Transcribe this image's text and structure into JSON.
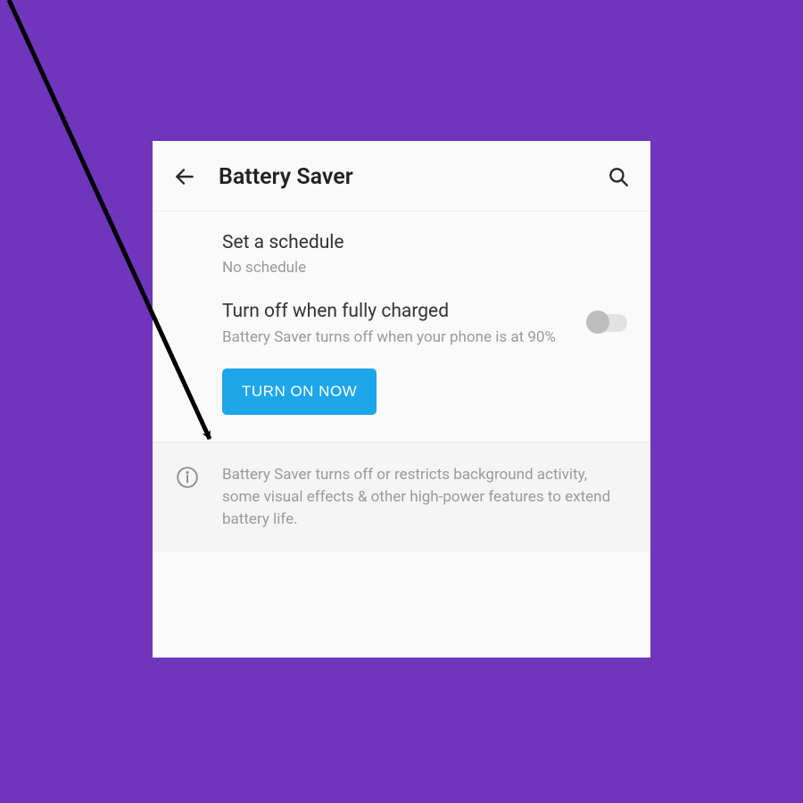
{
  "header": {
    "title": "Battery Saver"
  },
  "schedule": {
    "title": "Set a schedule",
    "subtitle": "No schedule"
  },
  "turnOff": {
    "title": "Turn off when fully charged",
    "subtitle": "Battery Saver turns off when your phone is at 90%"
  },
  "action": {
    "label": "TURN ON NOW"
  },
  "info": {
    "text": "Battery Saver turns off or restricts background activity, some visual effects & other high-power features to extend battery life."
  }
}
